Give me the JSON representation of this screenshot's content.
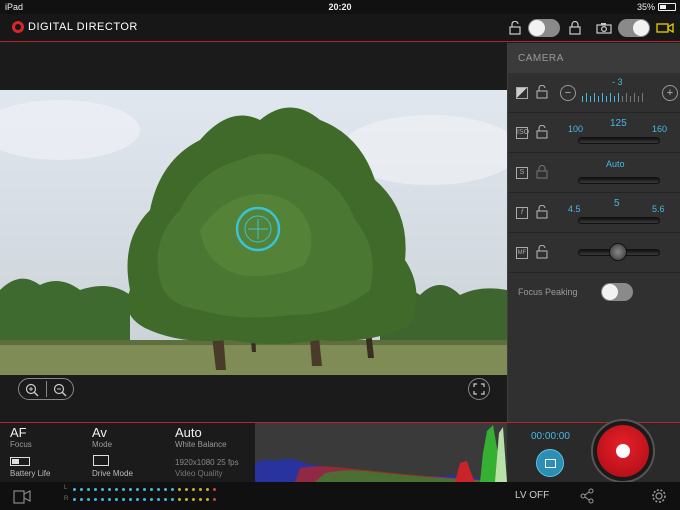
{
  "status_bar": {
    "device": "iPad",
    "time": "20:20",
    "battery": "35%",
    "battery_fraction": 0.35
  },
  "app": {
    "title": "DIGITAL DIRECTOR"
  },
  "top_controls": {
    "mode_toggle_on": true,
    "capture_toggle_on": true
  },
  "camera_panel": {
    "title": "CAMERA",
    "exposure": {
      "value": "- 3"
    },
    "iso": {
      "min": "100",
      "value": "125",
      "max": "160"
    },
    "shutter": {
      "value": "Auto"
    },
    "aperture": {
      "min": "4.5",
      "value": "5",
      "max": "5.6"
    },
    "focus": {
      "label": "MF"
    },
    "focus_peaking": {
      "label": "Focus Peaking",
      "on": false
    }
  },
  "info": {
    "af": "AF",
    "af_sub": "Focus",
    "mode": "Av",
    "mode_sub": "Mode",
    "wb": "Auto",
    "wb_sub": "White Balance",
    "battery_label": "Battery Life",
    "drive_label": "Drive Mode",
    "video_quality": "1920x1080 25 fps",
    "video_quality_sub": "Video Quality"
  },
  "recording": {
    "timecode": "00:00:00"
  },
  "footer": {
    "lv": "LV OFF",
    "meter_l": "L",
    "meter_r": "R"
  },
  "colors": {
    "accent": "#b3262a",
    "value_blue": "#48b7e3",
    "record_red": "#d0101a"
  }
}
